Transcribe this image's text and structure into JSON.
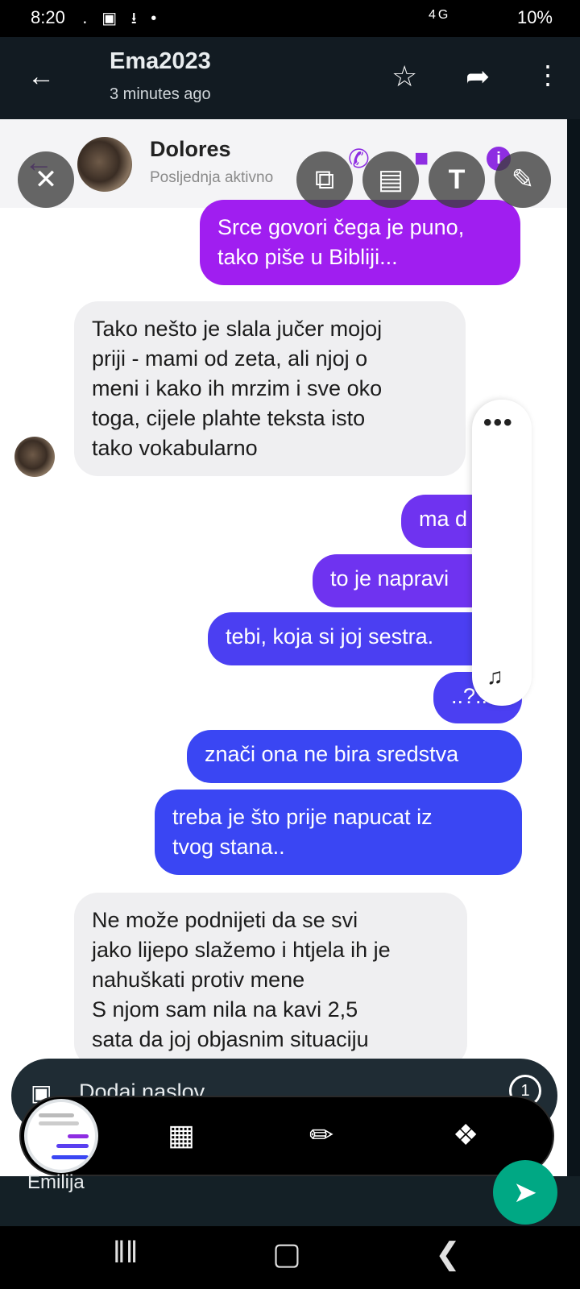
{
  "status_bar": {
    "time": "8:20",
    "left_icons": "․ ▣ ⭳ •",
    "network": "4G",
    "battery": "10%"
  },
  "header": {
    "title": "Ema2023",
    "subtitle": "3 minutes ago",
    "back_icon": "arrow-left-icon",
    "star_icon": "star-icon",
    "share_icon": "share-arrow-icon",
    "more_icon": "more-vertical-icon"
  },
  "screenshot": {
    "contact_name": "Dolores",
    "contact_status": "Posljednja aktivno",
    "messages": [
      {
        "dir": "out",
        "text_lines": [
          "Srce govori čega je puno,",
          "tako piše u Bibliji..."
        ]
      },
      {
        "dir": "in",
        "text_lines": [
          "Tako nešto je slala jučer mojoj",
          "priji - mami od zeta, ali njoj o",
          "meni i kako ih mrzim i sve oko",
          "toga, cijele plahte teksta isto",
          "tako vokabularno"
        ]
      },
      {
        "dir": "out",
        "text_lines": [
          "ma d"
        ]
      },
      {
        "dir": "out",
        "text_lines": [
          "to je napravi"
        ]
      },
      {
        "dir": "out",
        "text_lines": [
          "tebi, koja si joj sestra."
        ]
      },
      {
        "dir": "out",
        "text_lines": [
          "..?.."
        ]
      },
      {
        "dir": "out",
        "text_lines": [
          "znači ona ne bira sredstva"
        ]
      },
      {
        "dir": "out",
        "text_lines": [
          "treba je što prije napucat iz",
          "tvog stana.."
        ]
      },
      {
        "dir": "in",
        "text_lines": [
          "Ne može podnijeti da se svi",
          "jako lijepo slažemo i htjela ih je",
          "nahuškati protiv mene",
          "S njom sam nila na kavi 2,5",
          "sata da joj objasnim situaciju"
        ]
      }
    ],
    "side_dots": "•••",
    "side_music_icon": "music-note-icon"
  },
  "editor": {
    "close_icon": "close-icon",
    "crop_icon": "crop-rotate-icon",
    "sticker_icon": "sticker-icon",
    "text_icon": "text-icon",
    "draw_icon": "pencil-icon",
    "text_label": "T"
  },
  "caption": {
    "placeholder": "Dodaj naslov",
    "add_media_icon": "add-image-icon",
    "timer_label": "1"
  },
  "toolbar": {
    "scan_icon": "scan-icon",
    "edit_icon": "crop-edit-icon",
    "share_icon": "share-icon"
  },
  "footer": {
    "recipient": "Emilija",
    "send_icon": "send-icon"
  },
  "nav": {
    "recents_icon": "recents-icon",
    "home_icon": "home-icon",
    "back_icon": "back-chevron-icon"
  }
}
